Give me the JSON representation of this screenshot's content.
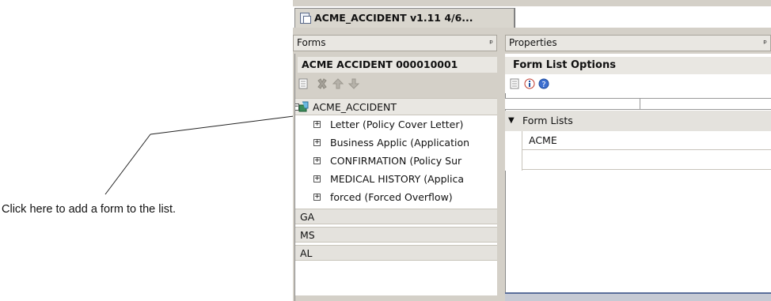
{
  "annotation": {
    "text": "Click here to add a form to the list."
  },
  "document_tab": {
    "label": "ACME_ACCIDENT v1.11 4/6..."
  },
  "forms_panel": {
    "title": "Forms",
    "pin": "ᵖ",
    "form_set_name": "ACME  ACCIDENT  000010001",
    "toolbar": [
      "properties-icon",
      "delete-icon",
      "move-up-icon",
      "move-down-icon"
    ],
    "root": "ACME_ACCIDENT",
    "items": [
      "Letter (Policy Cover Letter)",
      "Business Applic (Application",
      "CONFIRMATION (Policy Sur",
      "MEDICAL HISTORY (Applica",
      "forced (Forced Overflow)"
    ],
    "groups": [
      "GA",
      "MS",
      "AL"
    ]
  },
  "properties_panel": {
    "title": "Properties",
    "pin": "ᵖ",
    "section_title": "Form List Options",
    "toolbar": [
      "properties-icon",
      "info-icon",
      "help-icon"
    ],
    "category": "Form Lists",
    "rows": [
      "ACME",
      ""
    ]
  },
  "colors": {
    "accent": "#5a6e9a",
    "panel_bg": "#d4d0c8"
  }
}
